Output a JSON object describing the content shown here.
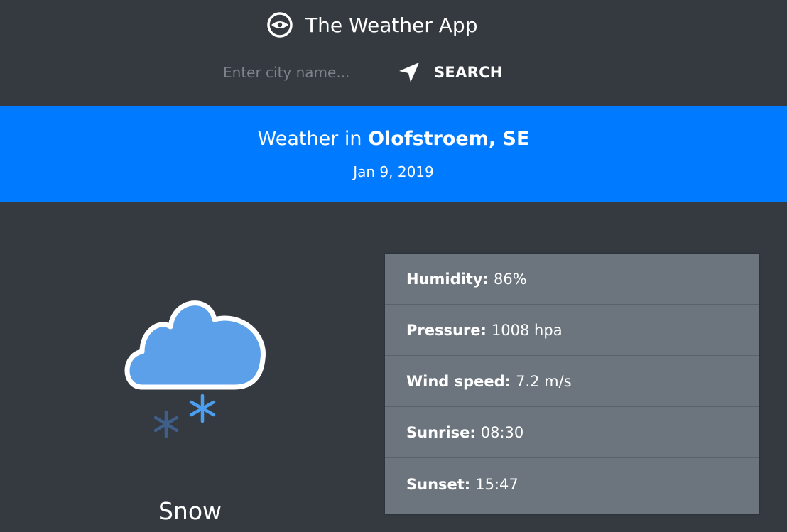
{
  "app": {
    "title": "The Weather App",
    "brand_icon": "eye-compass-icon"
  },
  "search": {
    "placeholder": "Enter city name...",
    "value": "",
    "button_label": "SEARCH",
    "button_icon": "location-arrow-icon"
  },
  "banner": {
    "prefix": "Weather in ",
    "city": "Olofstroem, SE",
    "date": "Jan 9, 2019",
    "color": "#007bff"
  },
  "current": {
    "icon": "snow-cloud-icon",
    "condition": "Snow"
  },
  "details": [
    {
      "label": "Humidity:",
      "value": "86%"
    },
    {
      "label": "Pressure:",
      "value": "1008 hpa"
    },
    {
      "label": "Wind speed:",
      "value": "7.2 m/s"
    },
    {
      "label": "Sunrise:",
      "value": "08:30"
    },
    {
      "label": "Sunset:",
      "value": "15:47"
    }
  ],
  "colors": {
    "background": "#343a40",
    "panel": "#6c757d",
    "cloud": "#5ba0e8",
    "snowflake_light": "#4a9ff0",
    "snowflake_dark": "#3d5f8a"
  }
}
